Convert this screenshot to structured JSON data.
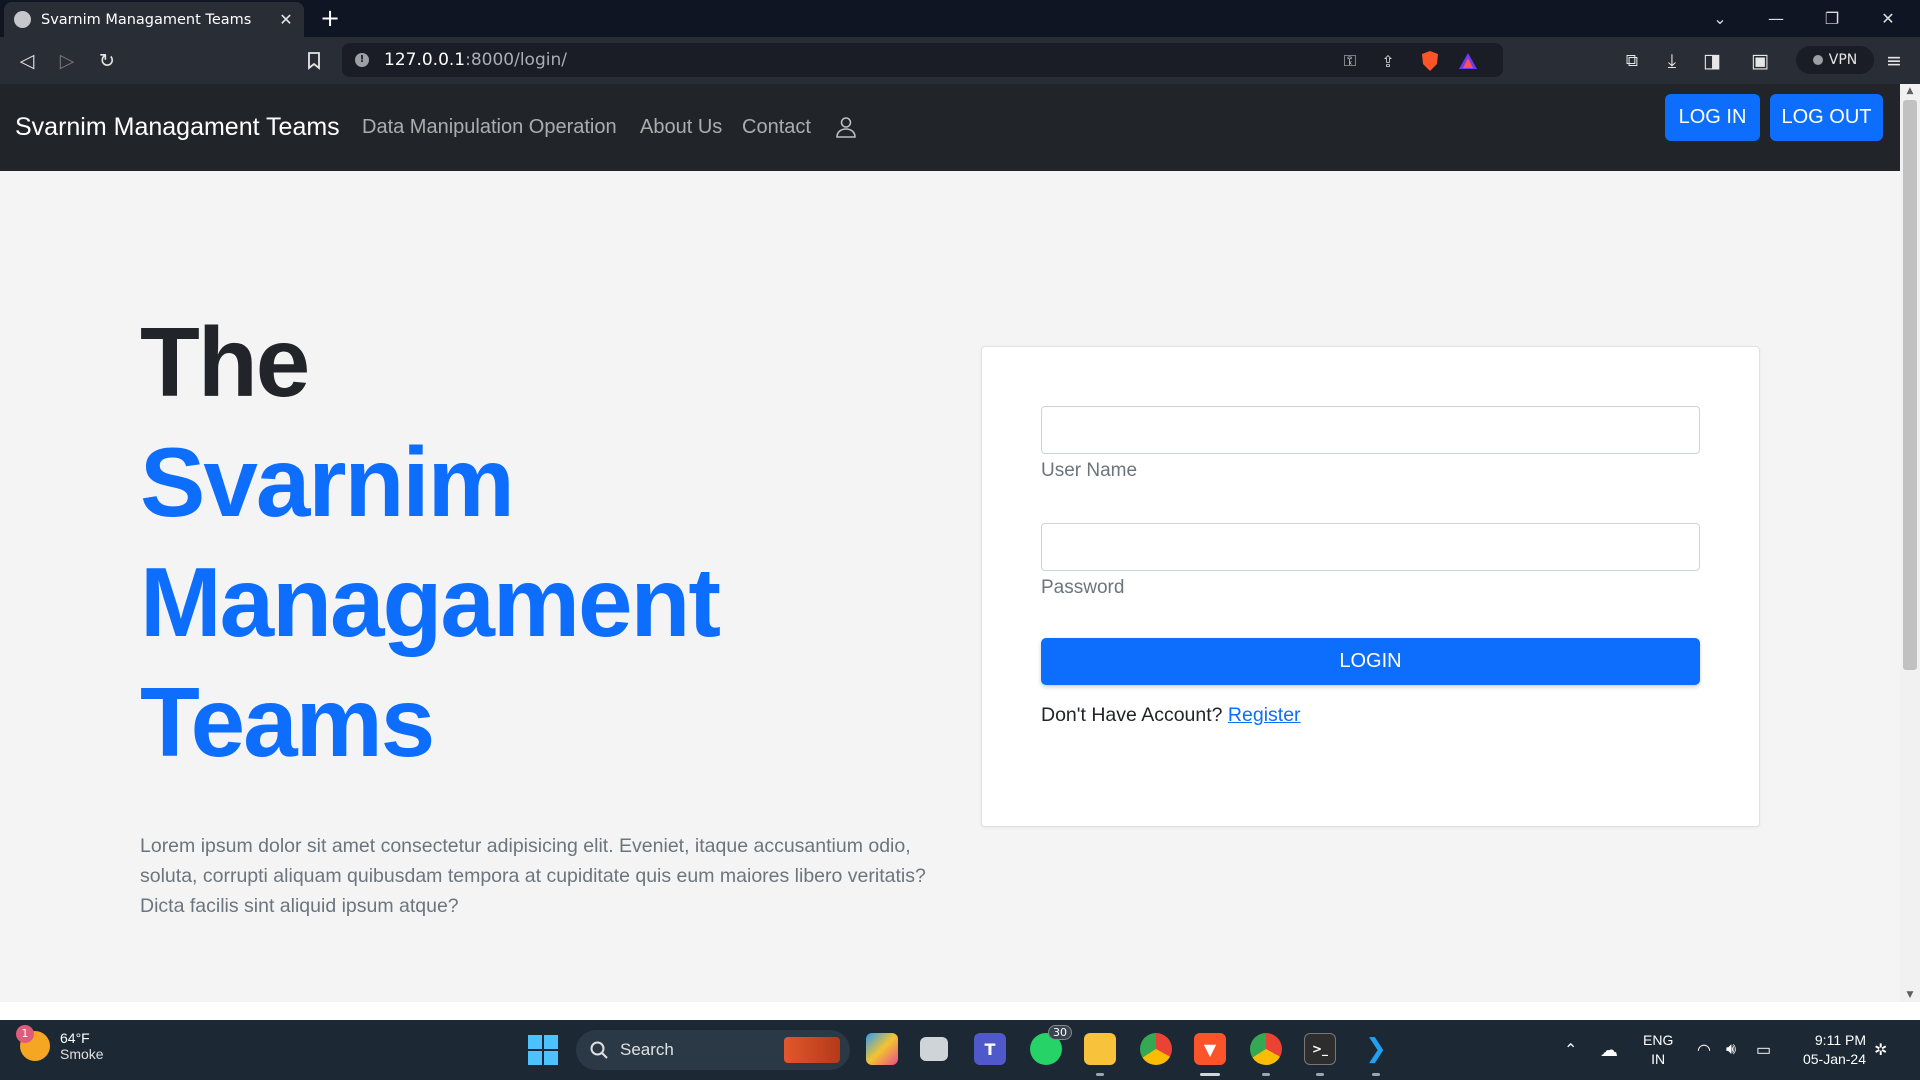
{
  "browser": {
    "tab_title": "Svarnim Managament Teams",
    "url_host": "127.0.0.1",
    "url_path": ":8000/login/",
    "vpn_label": "VPN"
  },
  "navbar": {
    "brand": "Svarnim Managament Teams",
    "links": [
      "Data Manipulation Operation",
      "About Us",
      "Contact"
    ],
    "login_button": "LOG IN",
    "logout_button": "LOG OUT"
  },
  "hero": {
    "line1": "The",
    "line2": "Svarnim",
    "line3": "Managament",
    "line4": "Teams",
    "lead": "Lorem ipsum dolor sit amet consectetur adipisicing elit. Eveniet, itaque accusantium odio, soluta, corrupti aliquam quibusdam tempora at cupiditate quis eum maiores libero veritatis? Dicta facilis sint aliquid ipsum atque?"
  },
  "login_form": {
    "username_label": "User Name",
    "username_value": "",
    "password_label": "Password",
    "password_value": "",
    "submit_label": "LOGIN",
    "register_prompt": "Don't Have Account?",
    "register_link": "Register"
  },
  "taskbar": {
    "weather_temp": "64°F",
    "weather_desc": "Smoke",
    "weather_badge": "1",
    "search_label": "Search",
    "whatsapp_badge": "30",
    "lang_line1": "ENG",
    "lang_line2": "IN",
    "time": "9:11 PM",
    "date": "05-Jan-24"
  },
  "colors": {
    "primary": "#0d6efd",
    "navbar_bg": "#212529",
    "page_bg": "#f4f4f4"
  }
}
